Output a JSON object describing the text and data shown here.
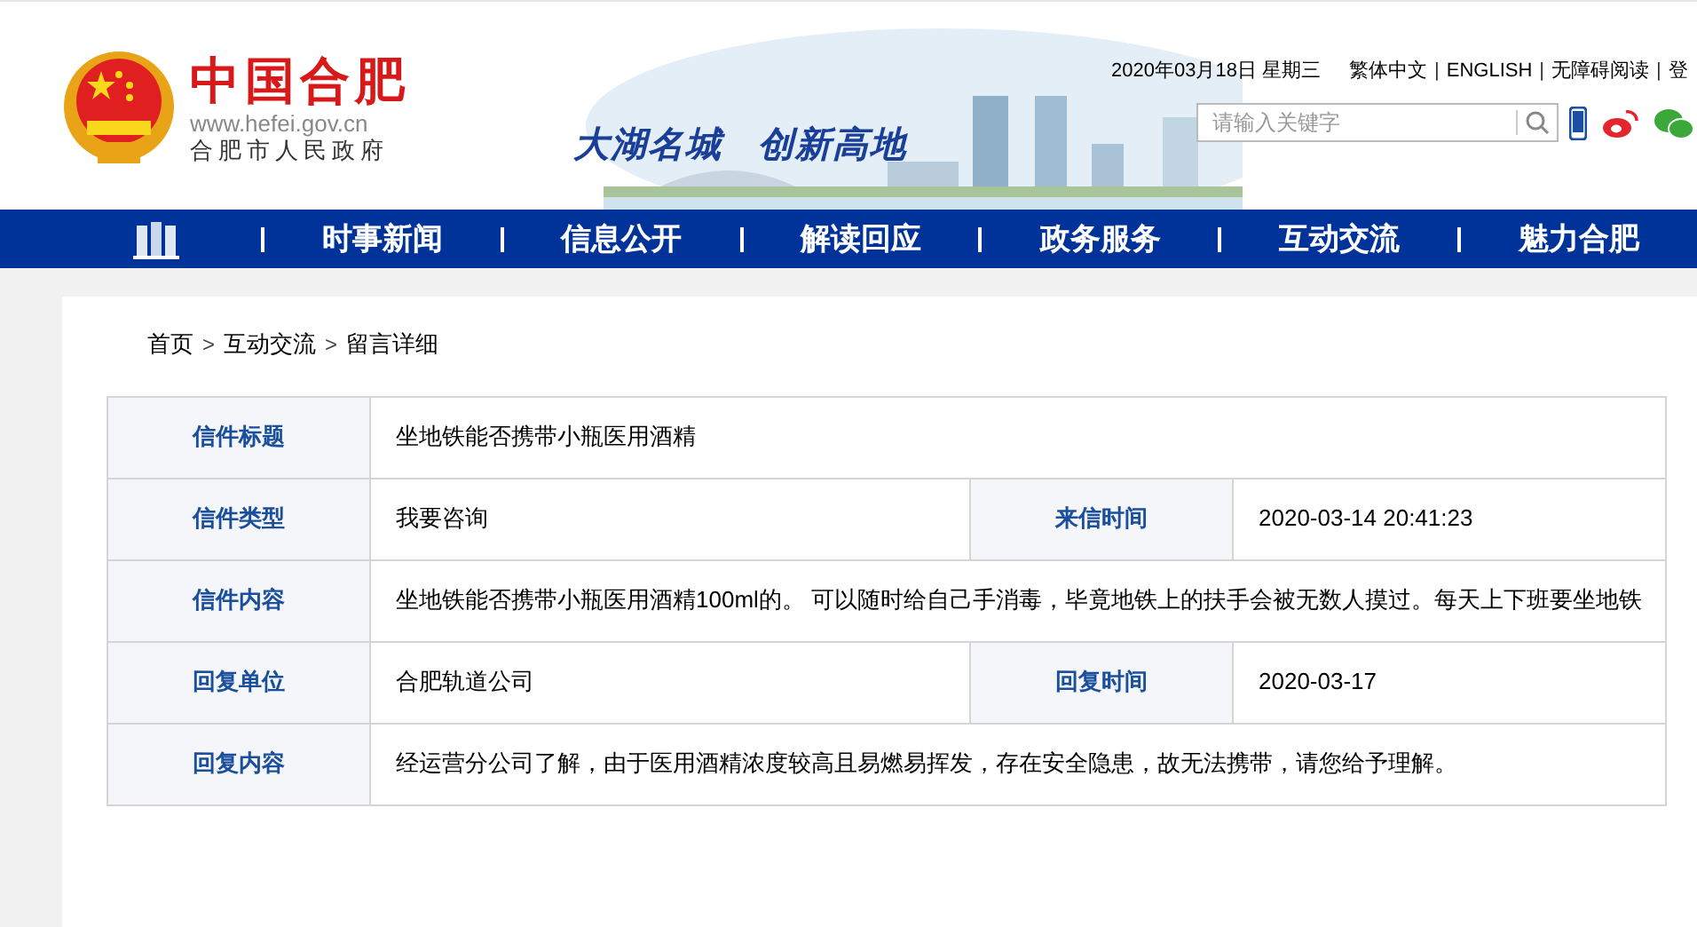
{
  "header": {
    "logo_title": "中国合肥",
    "url": "www.hefei.gov.cn",
    "subtitle": "合肥市人民政府",
    "slogan": [
      "大湖名城",
      "创新高地"
    ],
    "date": "2020年03月18日 星期三",
    "top_links": [
      {
        "kind": "link",
        "label": "繁体中文"
      },
      {
        "kind": "separator",
        "label": "|"
      },
      {
        "kind": "link",
        "label": "ENGLISH"
      },
      {
        "kind": "separator",
        "label": "|"
      },
      {
        "kind": "link",
        "label": "无障碍阅读"
      },
      {
        "kind": "separator",
        "label": "|"
      },
      {
        "kind": "link",
        "label": "登"
      }
    ],
    "search": {
      "placeholder": "请输入关键字"
    }
  },
  "nav": [
    {
      "kind": "icon"
    },
    {
      "kind": "text",
      "label": "时事新闻"
    },
    {
      "kind": "text",
      "label": "信息公开"
    },
    {
      "kind": "text",
      "label": "解读回应"
    },
    {
      "kind": "text",
      "label": "政务服务"
    },
    {
      "kind": "text",
      "label": "互动交流"
    },
    {
      "kind": "text",
      "label": "魅力合肥"
    }
  ],
  "breadcrumb": [
    {
      "kind": "link",
      "label": "首页"
    },
    {
      "kind": "separator",
      "label": ">"
    },
    {
      "kind": "link",
      "label": "互动交流"
    },
    {
      "kind": "separator",
      "label": ">"
    },
    {
      "kind": "link",
      "label": "留言详细"
    }
  ],
  "table": {
    "rows": [
      {
        "fields": [
          {
            "label": "信件标题",
            "value": "坐地铁能否携带小瓶医用酒精"
          }
        ]
      },
      {
        "fields": [
          {
            "label": "信件类型",
            "value": "我要咨询"
          },
          {
            "label": "来信时间",
            "value": "2020-03-14 20:41:23"
          }
        ]
      },
      {
        "fields": [
          {
            "label": "信件内容",
            "value": "坐地铁能否携带小瓶医用酒精100ml的。 可以随时给自己手消毒，毕竟地铁上的扶手会被无数人摸过。每天上下班要坐地铁"
          }
        ]
      },
      {
        "fields": [
          {
            "label": "回复单位",
            "value": "合肥轨道公司"
          },
          {
            "label": "回复时间",
            "value": "2020-03-17"
          }
        ]
      },
      {
        "fields": [
          {
            "label": "回复内容",
            "value": "经运营分公司了解，由于医用酒精浓度较高且易燃易挥发，存在安全隐患，故无法携带，请您给予理解。"
          }
        ]
      }
    ]
  }
}
